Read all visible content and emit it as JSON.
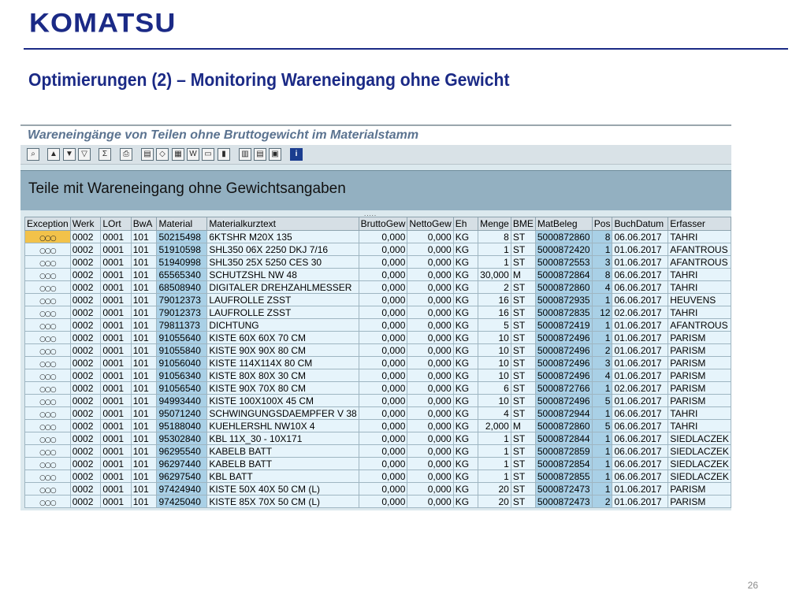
{
  "logo": "KOMATSU",
  "slide_title": "Optimierungen (2) – Monitoring Wareneingang ohne Gewicht",
  "sap": {
    "window_title": "Wareneingänge von Teilen ohne Bruttogewicht im Materialstamm",
    "toolbar_icons": [
      "details-icon",
      "first-page-icon",
      "filter-icon",
      "set-filter-icon",
      "sum-icon",
      "print-icon",
      "export-icon",
      "abc-analysis-icon",
      "spreadsheet-icon",
      "word-processing-icon",
      "local-file-icon",
      "graphic-icon",
      "layout-icon",
      "select-layout-icon",
      "save-layout-icon",
      "info-icon"
    ],
    "report_header": "Teile mit Wareneingang ohne Gewichtsangaben",
    "columns": [
      "Exception",
      "Werk",
      "LOrt",
      "BwA",
      "Material",
      "Materialkurztext",
      "BruttoGew",
      "NettoGew",
      "Eh",
      "Menge",
      "BME",
      "MatBeleg",
      "Pos",
      "BuchDatum",
      "Erfasser"
    ],
    "exception_symbol": "○○○",
    "rows": [
      [
        "0002",
        "0001",
        "101",
        "50215498",
        "6KTSHR M20X 135",
        "0,000",
        "0,000",
        "KG",
        "8",
        "ST",
        "5000872860",
        "8",
        "06.06.2017",
        "TAHRI"
      ],
      [
        "0002",
        "0001",
        "101",
        "51910598",
        "SHL350 06X 2250 DKJ 7/16",
        "0,000",
        "0,000",
        "KG",
        "1",
        "ST",
        "5000872420",
        "1",
        "01.06.2017",
        "AFANTROUS"
      ],
      [
        "0002",
        "0001",
        "101",
        "51940998",
        "SHL350 25X 5250 CES 30",
        "0,000",
        "0,000",
        "KG",
        "1",
        "ST",
        "5000872553",
        "3",
        "01.06.2017",
        "AFANTROUS"
      ],
      [
        "0002",
        "0001",
        "101",
        "65565340",
        "SCHUTZSHL NW 48",
        "0,000",
        "0,000",
        "KG",
        "30,000",
        "M",
        "5000872864",
        "8",
        "06.06.2017",
        "TAHRI"
      ],
      [
        "0002",
        "0001",
        "101",
        "68508940",
        "DIGITALER DREHZAHLMESSER",
        "0,000",
        "0,000",
        "KG",
        "2",
        "ST",
        "5000872860",
        "4",
        "06.06.2017",
        "TAHRI"
      ],
      [
        "0002",
        "0001",
        "101",
        "79012373",
        "LAUFROLLE ZSST",
        "0,000",
        "0,000",
        "KG",
        "16",
        "ST",
        "5000872935",
        "1",
        "06.06.2017",
        "HEUVENS"
      ],
      [
        "0002",
        "0001",
        "101",
        "79012373",
        "LAUFROLLE ZSST",
        "0,000",
        "0,000",
        "KG",
        "16",
        "ST",
        "5000872835",
        "12",
        "02.06.2017",
        "TAHRI"
      ],
      [
        "0002",
        "0001",
        "101",
        "79811373",
        "DICHTUNG",
        "0,000",
        "0,000",
        "KG",
        "5",
        "ST",
        "5000872419",
        "1",
        "01.06.2017",
        "AFANTROUS"
      ],
      [
        "0002",
        "0001",
        "101",
        "91055640",
        "KISTE  60X 60X 70 CM",
        "0,000",
        "0,000",
        "KG",
        "10",
        "ST",
        "5000872496",
        "1",
        "01.06.2017",
        "PARISM"
      ],
      [
        "0002",
        "0001",
        "101",
        "91055840",
        "KISTE  90X 90X 80 CM",
        "0,000",
        "0,000",
        "KG",
        "10",
        "ST",
        "5000872496",
        "2",
        "01.06.2017",
        "PARISM"
      ],
      [
        "0002",
        "0001",
        "101",
        "91056040",
        "KISTE 114X114X 80 CM",
        "0,000",
        "0,000",
        "KG",
        "10",
        "ST",
        "5000872496",
        "3",
        "01.06.2017",
        "PARISM"
      ],
      [
        "0002",
        "0001",
        "101",
        "91056340",
        "KISTE  80X 80X 30 CM",
        "0,000",
        "0,000",
        "KG",
        "10",
        "ST",
        "5000872496",
        "4",
        "01.06.2017",
        "PARISM"
      ],
      [
        "0002",
        "0001",
        "101",
        "91056540",
        "KISTE  90X 70X 80 CM",
        "0,000",
        "0,000",
        "KG",
        "6",
        "ST",
        "5000872766",
        "1",
        "02.06.2017",
        "PARISM"
      ],
      [
        "0002",
        "0001",
        "101",
        "94993440",
        "KISTE 100X100X 45 CM",
        "0,000",
        "0,000",
        "KG",
        "10",
        "ST",
        "5000872496",
        "5",
        "01.06.2017",
        "PARISM"
      ],
      [
        "0002",
        "0001",
        "101",
        "95071240",
        "SCHWINGUNGSDAEMPFER V  38",
        "0,000",
        "0,000",
        "KG",
        "4",
        "ST",
        "5000872944",
        "1",
        "06.06.2017",
        "TAHRI"
      ],
      [
        "0002",
        "0001",
        "101",
        "95188040",
        "KUEHLERSHL NW10X 4",
        "0,000",
        "0,000",
        "KG",
        "2,000",
        "M",
        "5000872860",
        "5",
        "06.06.2017",
        "TAHRI"
      ],
      [
        "0002",
        "0001",
        "101",
        "95302840",
        "KBL 11X_30 - 10X171",
        "0,000",
        "0,000",
        "KG",
        "1",
        "ST",
        "5000872844",
        "1",
        "06.06.2017",
        "SIEDLACZEK"
      ],
      [
        "0002",
        "0001",
        "101",
        "96295540",
        "KABELB BATT",
        "0,000",
        "0,000",
        "KG",
        "1",
        "ST",
        "5000872859",
        "1",
        "06.06.2017",
        "SIEDLACZEK"
      ],
      [
        "0002",
        "0001",
        "101",
        "96297440",
        "KABELB BATT",
        "0,000",
        "0,000",
        "KG",
        "1",
        "ST",
        "5000872854",
        "1",
        "06.06.2017",
        "SIEDLACZEK"
      ],
      [
        "0002",
        "0001",
        "101",
        "96297540",
        "KBL BATT",
        "0,000",
        "0,000",
        "KG",
        "1",
        "ST",
        "5000872855",
        "1",
        "06.06.2017",
        "SIEDLACZEK"
      ],
      [
        "0002",
        "0001",
        "101",
        "97424940",
        "KISTE  50X 40X 50 CM (L)",
        "0,000",
        "0,000",
        "KG",
        "20",
        "ST",
        "5000872473",
        "1",
        "01.06.2017",
        "PARISM"
      ],
      [
        "0002",
        "0001",
        "101",
        "97425040",
        "KISTE  85X 70X 50 CM (L)",
        "0,000",
        "0,000",
        "KG",
        "20",
        "ST",
        "5000872473",
        "2",
        "01.06.2017",
        "PARISM"
      ]
    ]
  },
  "page_number": "26",
  "colors": {
    "brand": "#1b2a86",
    "key_column": "#a9d0e6",
    "grid_row": "#e6f4fb",
    "selected_exception": "#f2c24a"
  }
}
